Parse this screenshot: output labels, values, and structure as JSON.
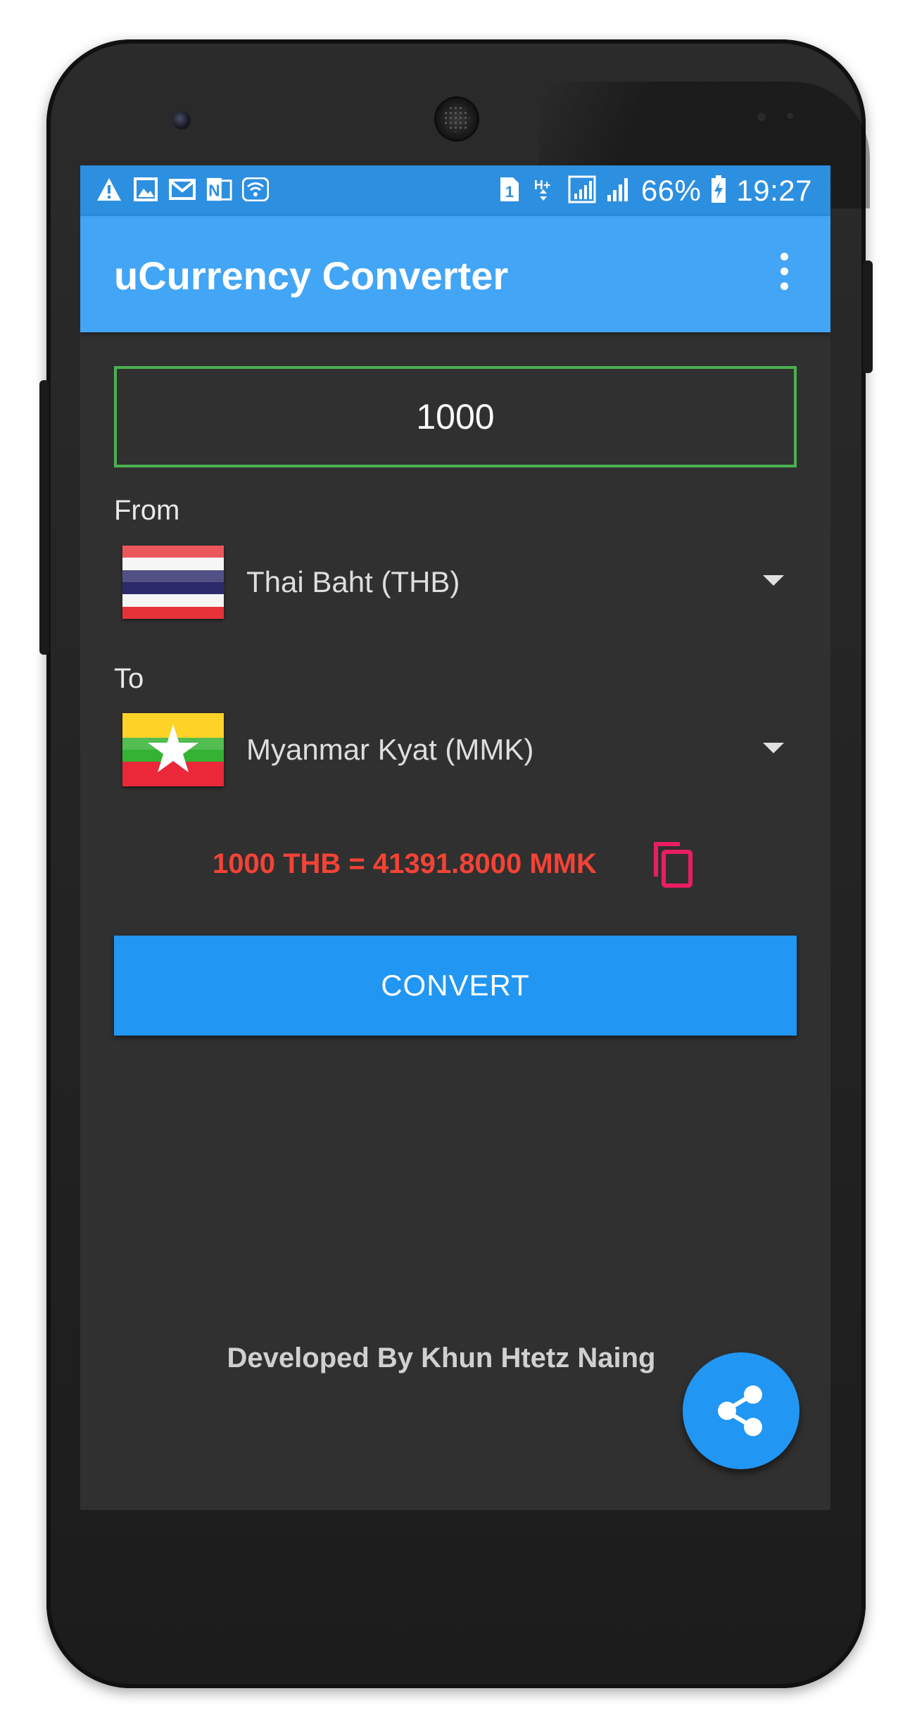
{
  "status_bar": {
    "battery": "66%",
    "time": "19:27",
    "network": "H+",
    "sim": "1",
    "left_icons": [
      "alert-icon",
      "image-icon",
      "mail-icon",
      "onenote-icon",
      "wifi-icon"
    ]
  },
  "app_bar": {
    "title": "uCurrency Converter"
  },
  "amount_input": {
    "value": "1000"
  },
  "from": {
    "label": "From",
    "currency": "Thai Baht (THB)",
    "flag": "thailand-flag-icon"
  },
  "to": {
    "label": "To",
    "currency": "Myanmar Kyat (MMK)",
    "flag": "myanmar-flag-icon"
  },
  "result": {
    "text": "1000 THB = 41391.8000 MMK"
  },
  "convert_button": {
    "label": "CONVERT"
  },
  "footer": {
    "credit": "Developed By Khun Htetz Naing"
  },
  "colors": {
    "status_bar": "#2d8fe0",
    "app_bar": "#42a5f5",
    "background": "#303030",
    "input_border": "#4caf50",
    "result_text": "#f44336",
    "copy_icon": "#e91e63",
    "button": "#2196f3"
  }
}
